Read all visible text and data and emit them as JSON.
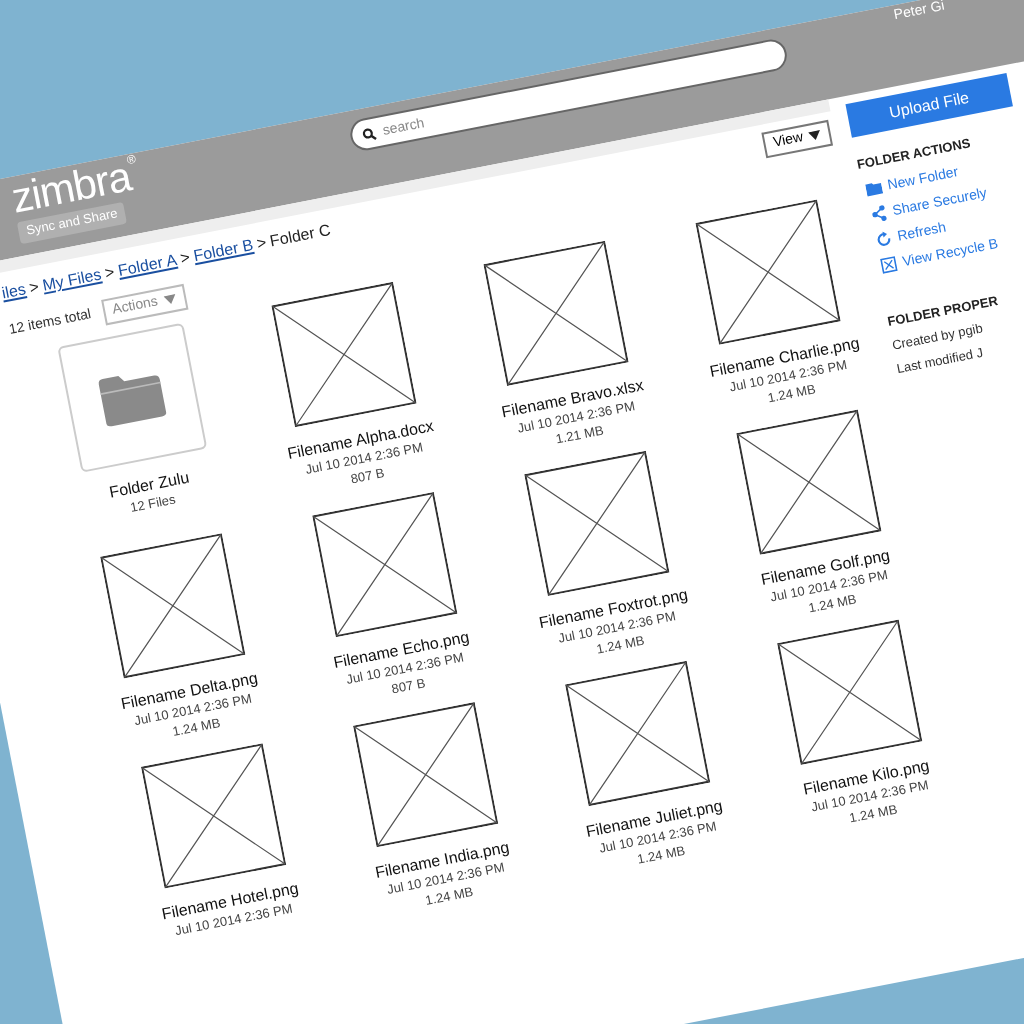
{
  "header": {
    "logo": "zimbra",
    "logo_mark": "®",
    "tagline": "Sync and Share",
    "search": {
      "placeholder": "search"
    },
    "user": "Peter Gi"
  },
  "breadcrumb": [
    {
      "label": "iles",
      "link": true,
      "separator": ">"
    },
    {
      "label": "My Files",
      "link": true,
      "separator": ">"
    },
    {
      "label": "Folder A",
      "link": true,
      "separator": ">"
    },
    {
      "label": "Folder B",
      "link": true,
      "separator": ">"
    },
    {
      "label": "Folder C",
      "link": false
    }
  ],
  "view_button": "View",
  "item_count": "12 items total",
  "actions_button": {
    "label": "Actions",
    "disabled": true
  },
  "items": [
    {
      "kind": "folder",
      "name": "Folder Zulu",
      "meta": [
        "12 Files"
      ]
    },
    {
      "kind": "file",
      "name": "Filename Alpha.docx",
      "meta": [
        "Jul 10 2014 2:36 PM",
        "807 B"
      ]
    },
    {
      "kind": "file",
      "name": "Filename Bravo.xlsx",
      "meta": [
        "Jul 10 2014 2:36 PM",
        "1.21 MB"
      ]
    },
    {
      "kind": "file",
      "name": "Filename Charlie.png",
      "meta": [
        "Jul 10 2014 2:36 PM",
        "1.24 MB"
      ]
    },
    {
      "kind": "file",
      "name": "Filename Delta.png",
      "meta": [
        "Jul 10 2014 2:36 PM",
        "1.24 MB"
      ]
    },
    {
      "kind": "file",
      "name": "Filename Echo.png",
      "meta": [
        "Jul 10 2014 2:36 PM",
        "807 B"
      ]
    },
    {
      "kind": "file",
      "name": "Filename Foxtrot.png",
      "meta": [
        "Jul 10 2014 2:36 PM",
        "1.24 MB"
      ]
    },
    {
      "kind": "file",
      "name": "Filename Golf.png",
      "meta": [
        "Jul 10 2014 2:36 PM",
        "1.24 MB"
      ]
    },
    {
      "kind": "file",
      "name": "Filename Hotel.png",
      "meta": [
        "Jul 10 2014 2:36 PM"
      ]
    },
    {
      "kind": "file",
      "name": "Filename India.png",
      "meta": [
        "Jul 10 2014 2:36 PM",
        "1.24 MB"
      ]
    },
    {
      "kind": "file",
      "name": "Filename Juliet.png",
      "meta": [
        "Jul 10 2014 2:36 PM",
        "1.24 MB"
      ]
    },
    {
      "kind": "file",
      "name": "Filename Kilo.png",
      "meta": [
        "Jul 10 2014 2:36 PM",
        "1.24 MB"
      ]
    }
  ],
  "sidebar": {
    "upload_button": "Upload File",
    "actions_title": "FOLDER ACTIONS",
    "actions": [
      {
        "kind": "folder",
        "label": "New Folder"
      },
      {
        "kind": "share",
        "label": "Share Securely"
      },
      {
        "kind": "refresh",
        "label": "Refresh"
      },
      {
        "kind": "recycle",
        "label": "View Recycle B"
      }
    ],
    "properties_title": "FOLDER PROPER",
    "properties": [
      "Created by pgib",
      "Last modified J"
    ]
  }
}
